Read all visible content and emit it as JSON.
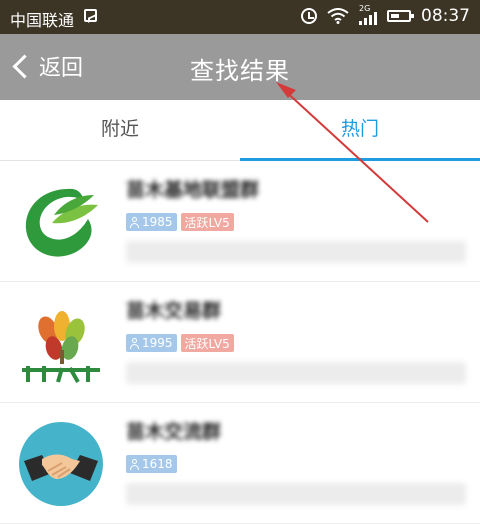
{
  "status_bar": {
    "carrier": "中国联通",
    "signal_tag": "2G",
    "time": "08:37"
  },
  "header": {
    "back_label": "返回",
    "title": "查找结果"
  },
  "tabs": [
    {
      "label": "附近",
      "active": false
    },
    {
      "label": "热门",
      "active": true
    }
  ],
  "results": [
    {
      "name": "苗木基地联盟群",
      "members": "1985",
      "active_level": "活跃LV5"
    },
    {
      "name": "苗木交易群",
      "members": "1995",
      "active_level": "活跃LV5"
    },
    {
      "name": "苗木交流群",
      "members": "1618",
      "active_level": ""
    }
  ],
  "colors": {
    "status_bar": "#3c3424",
    "header": "#9a9a9a",
    "accent": "#1f9be0",
    "members_badge": "#a5c8ea",
    "active_badge": "#f0a8a0",
    "annotation_arrow": "#d43a3a"
  }
}
